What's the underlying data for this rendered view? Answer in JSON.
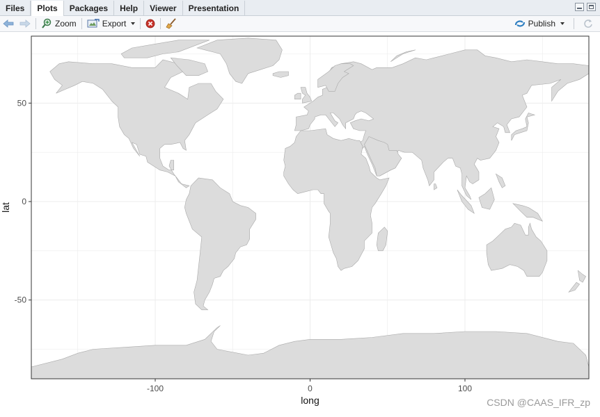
{
  "tabs": [
    {
      "label": "Files",
      "active": false
    },
    {
      "label": "Plots",
      "active": true
    },
    {
      "label": "Packages",
      "active": false
    },
    {
      "label": "Help",
      "active": false
    },
    {
      "label": "Viewer",
      "active": false
    },
    {
      "label": "Presentation",
      "active": false
    }
  ],
  "toolbar": {
    "back_icon": "arrow-left-icon",
    "forward_icon": "arrow-right-icon",
    "zoom_label": "Zoom",
    "export_label": "Export",
    "remove_icon": "remove-plot-icon",
    "clear_icon": "broom-icon",
    "publish_label": "Publish",
    "refresh_icon": "refresh-icon"
  },
  "colors": {
    "land_fill": "#dcdcdc",
    "land_stroke": "#a9a9a9",
    "grid": "#ececec",
    "panel_border": "#333333"
  },
  "chart_data": {
    "type": "map",
    "xlabel": "long",
    "ylabel": "lat",
    "xlim": [
      -180,
      180
    ],
    "ylim": [
      -90,
      84
    ],
    "x_ticks": [
      -100,
      0,
      100
    ],
    "y_ticks": [
      -50,
      0,
      50
    ],
    "x_tick_labels": [
      "-100",
      "0",
      "100"
    ],
    "y_tick_labels": [
      "-50",
      "0",
      "50"
    ],
    "grid": true,
    "theme": "bw"
  },
  "watermark": "CSDN @CAAS_IFR_zp"
}
